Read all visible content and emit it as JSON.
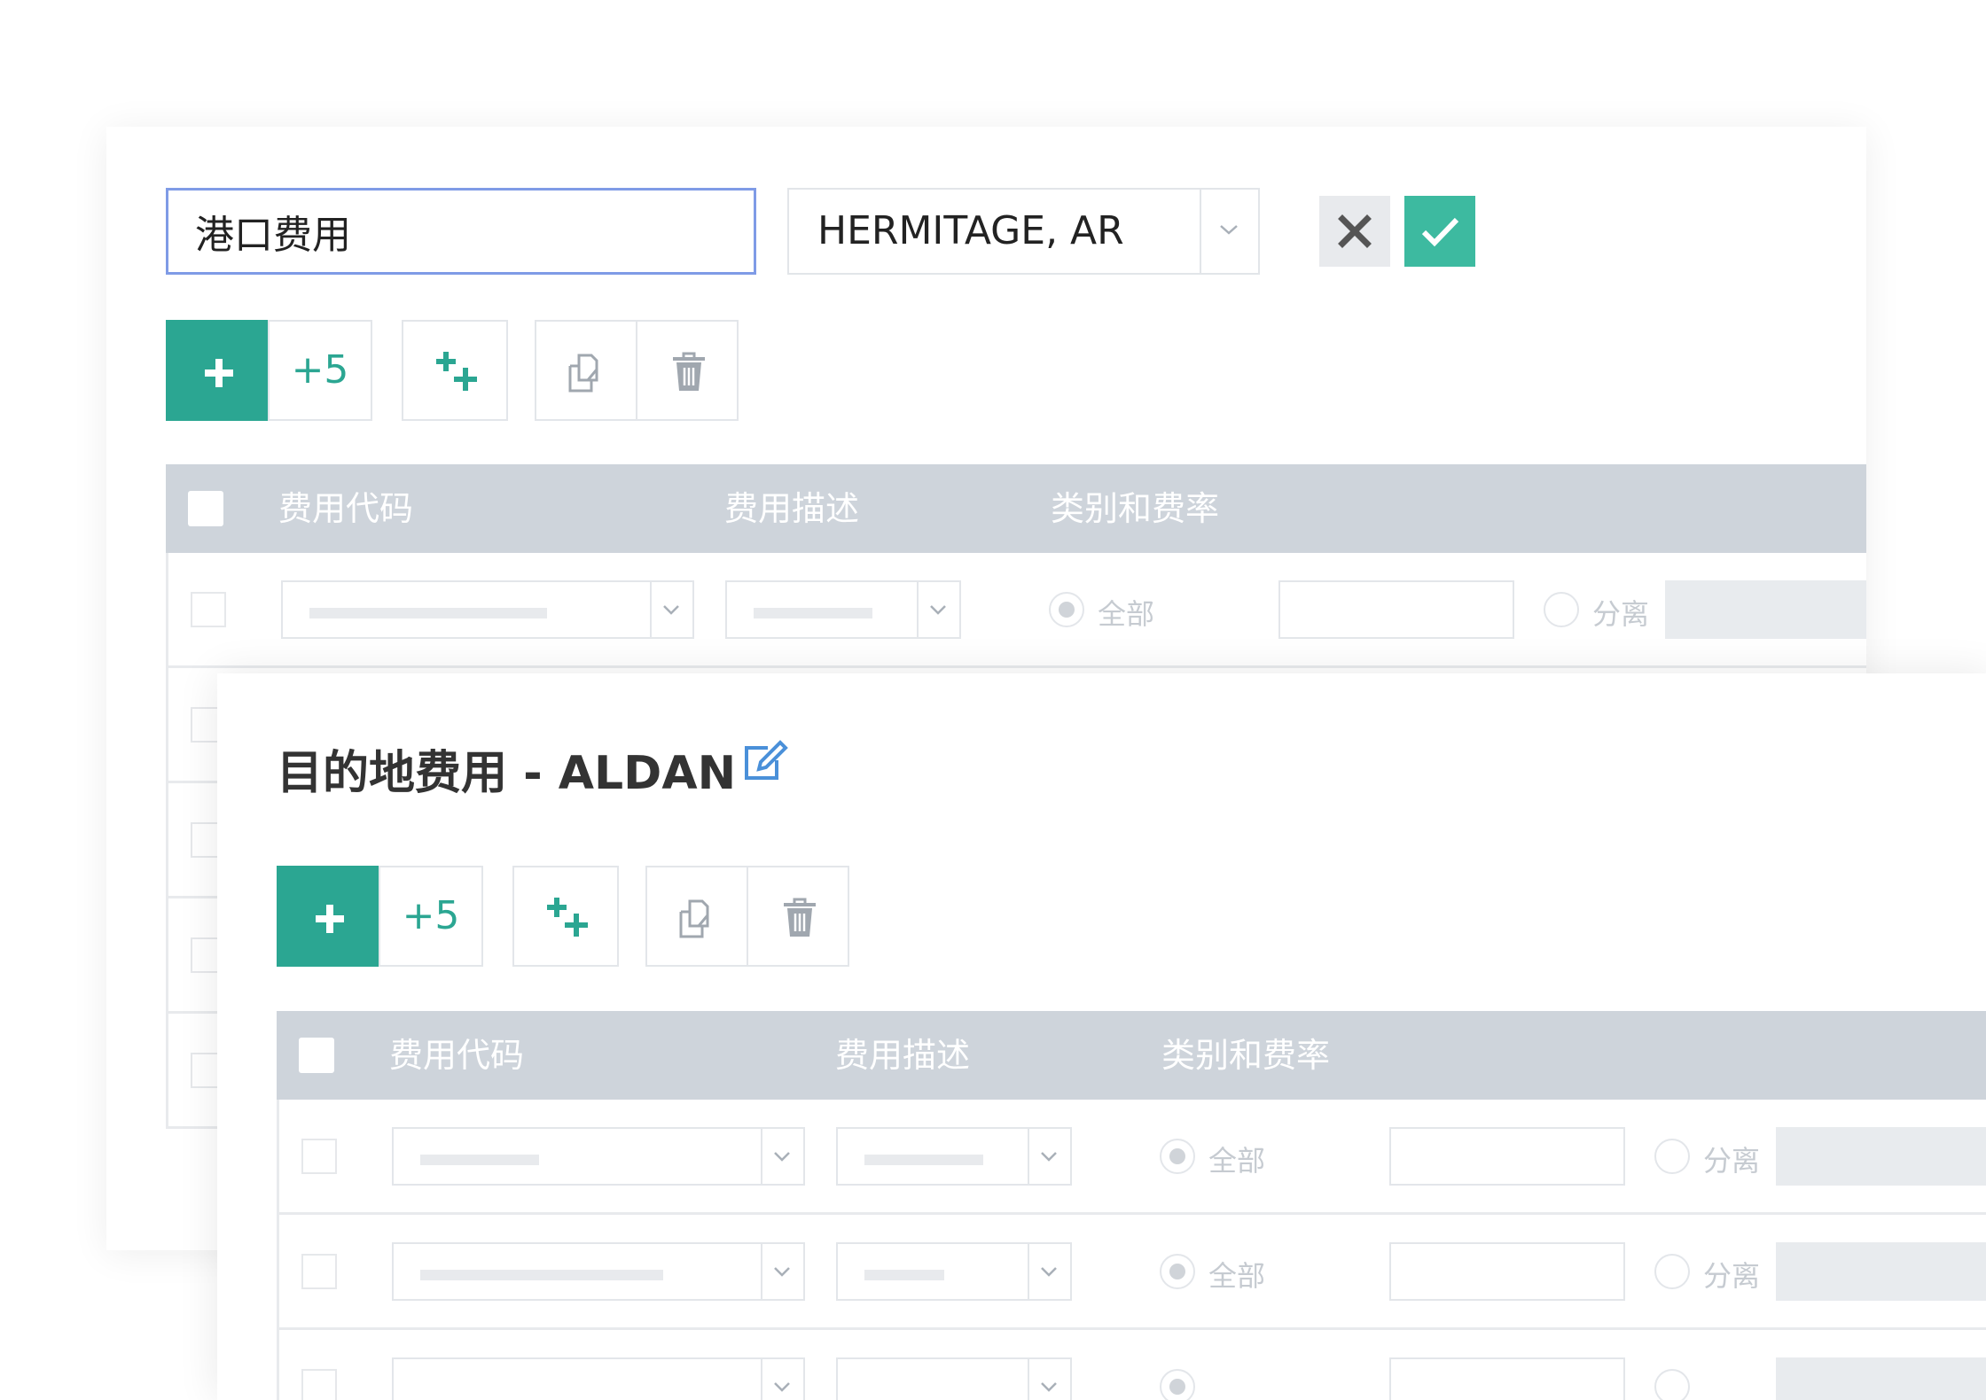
{
  "editor": {
    "name_value": "港口费用",
    "location_value": "HERMITAGE, AR",
    "cancel_icon": "close-icon",
    "confirm_icon": "check-icon"
  },
  "toolbar": {
    "add_icon": "plus-icon",
    "add_five_label": "+5",
    "add_multiple_icon": "multi-plus-icon",
    "copy_icon": "copy-icon",
    "delete_icon": "trash-icon"
  },
  "table": {
    "headers": {
      "code": "费用代码",
      "description": "费用描述",
      "category_rate": "类别和费率"
    },
    "radio_all": "全部",
    "radio_split": "分离"
  },
  "section2": {
    "title": "目的地费用 - ALDAN",
    "edit_icon": "edit-icon"
  },
  "colors": {
    "accent": "#2ba692",
    "confirm": "#3dbaa0",
    "header_bg": "#ced4db",
    "focus_border": "#7f9be6"
  }
}
